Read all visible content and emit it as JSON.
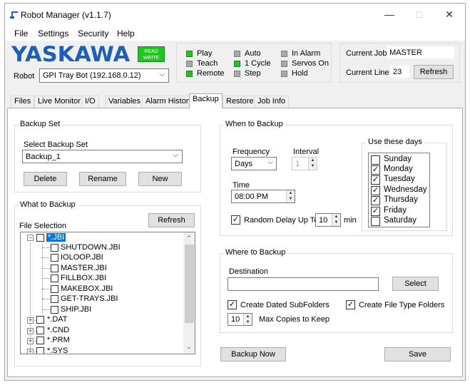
{
  "window": {
    "title": "Robot Manager (v1.1.7)",
    "minimize": "—",
    "maximize": "□",
    "close": "✕"
  },
  "menu": [
    "File",
    "Settings",
    "Security",
    "Help"
  ],
  "header": {
    "logo": "YASKAWA",
    "mode_badge": {
      "line1": "READ",
      "line2": "WRITE",
      "color": "#22c422"
    },
    "robot_label": "Robot",
    "robot_selected": "GPI Tray Bot (192.168.0.12)"
  },
  "status": [
    {
      "label": "Play",
      "on": true
    },
    {
      "label": "Teach",
      "on": false
    },
    {
      "label": "Remote",
      "on": true
    },
    {
      "label": "Auto",
      "on": false
    },
    {
      "label": "1 Cycle",
      "on": true
    },
    {
      "label": "Step",
      "on": false
    },
    {
      "label": "In Alarm",
      "on": false
    },
    {
      "label": "Servos On",
      "on": false
    },
    {
      "label": "Hold",
      "on": false
    }
  ],
  "job": {
    "current_job_label": "Current Job",
    "current_job_value": "MASTER",
    "current_line_label": "Current Line",
    "current_line_value": "23",
    "refresh_label": "Refresh"
  },
  "tabs": [
    "Files",
    "Live Monitor",
    "I/O",
    "Variables",
    "Alarm History",
    "Backup",
    "Restore",
    "Job Info"
  ],
  "active_tab": "Backup",
  "backup_set": {
    "group_label": "Backup Set",
    "select_label": "Select Backup Set",
    "selected": "Backup_1",
    "delete_label": "Delete",
    "rename_label": "Rename",
    "new_label": "New"
  },
  "what_to_backup": {
    "group_label": "What to Backup",
    "file_selection_label": "File Selection",
    "refresh_label": "Refresh",
    "tree": {
      "root": [
        "*.JBI",
        "*.DAT",
        "*.CND",
        "*.PRM",
        "*.SYS"
      ],
      "jbi_children": [
        "SHUTDOWN.JBI",
        "IOLOOP.JBI",
        "MASTER.JBI",
        "FILLBOX.JBI",
        "MAKEBOX.JBI",
        "GET-TRAYS.JBI",
        "SHIP.JBI"
      ]
    }
  },
  "when_to_backup": {
    "group_label": "When to Backup",
    "frequency_label": "Frequency",
    "frequency_value": "Days",
    "interval_label": "Interval",
    "interval_value": "1",
    "time_label": "Time",
    "time_value": "08:00 PM",
    "random_delay_label": "Random Delay Up To",
    "random_delay_value": "10",
    "random_delay_unit": "min",
    "random_delay_checked": true,
    "days_label": "Use these days",
    "days": [
      {
        "name": "Sunday",
        "checked": false
      },
      {
        "name": "Monday",
        "checked": true
      },
      {
        "name": "Tuesday",
        "checked": true
      },
      {
        "name": "Wednesday",
        "checked": true
      },
      {
        "name": "Thursday",
        "checked": true
      },
      {
        "name": "Friday",
        "checked": true
      },
      {
        "name": "Saturday",
        "checked": false
      }
    ]
  },
  "where_to_backup": {
    "group_label": "Where to Backup",
    "destination_label": "Destination",
    "destination_value": "",
    "select_label": "Select",
    "dated_subfolders_label": "Create Dated SubFolders",
    "dated_subfolders_checked": true,
    "file_type_folders_label": "Create File Type Folders",
    "file_type_folders_checked": true,
    "max_copies_value": "10",
    "max_copies_label": "Max Copies to Keep"
  },
  "footer": {
    "backup_now_label": "Backup Now",
    "save_label": "Save"
  },
  "colors": {
    "accent_blue": "#1f5fb8",
    "led_on": "#22c422",
    "led_off": "#a9a9a9",
    "selection": "#0078d7"
  }
}
